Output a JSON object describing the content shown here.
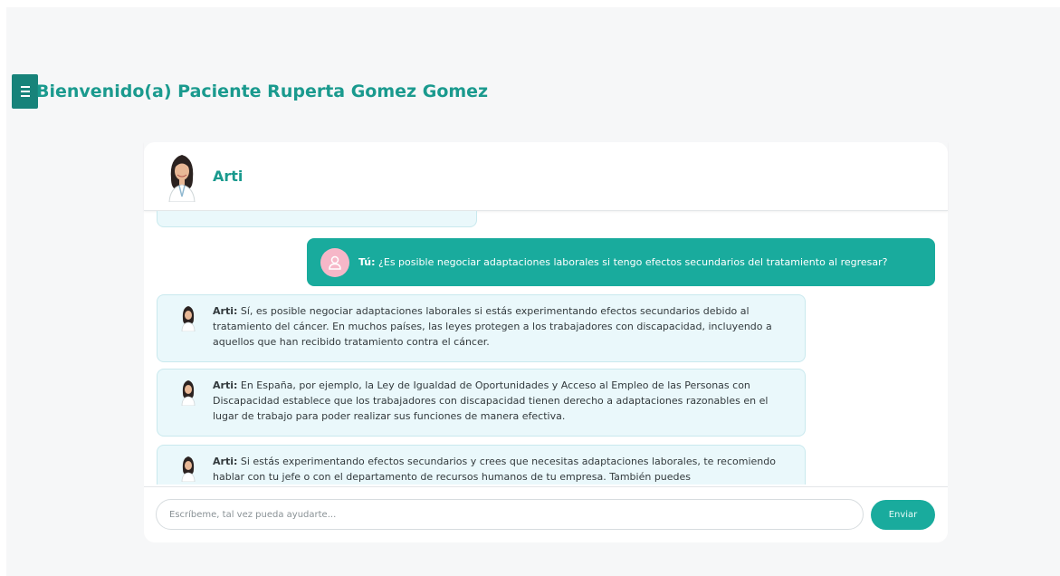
{
  "menu": {
    "icon": "hamburger-menu-icon"
  },
  "header": {
    "welcome": "Bienvenido(a) Paciente Ruperta Gomez Gomez"
  },
  "chat": {
    "bot_name": "Arti",
    "bot_avatar_icon": "doctor-avatar-icon",
    "user_avatar_icon": "user-avatar-icon",
    "messages": [
      {
        "sender": "Tú:",
        "text": " ¿Es posible negociar adaptaciones laborales si tengo efectos secundarios del tratamiento al regresar?"
      },
      {
        "sender": "Arti:",
        "text": " Sí, es posible negociar adaptaciones laborales si estás experimentando efectos secundarios debido al tratamiento del cáncer. En muchos países, las leyes protegen a los trabajadores con discapacidad, incluyendo a aquellos que han recibido tratamiento contra el cáncer."
      },
      {
        "sender": "Arti:",
        "text": " En España, por ejemplo, la Ley de Igualdad de Oportunidades y Acceso al Empleo de las Personas con Discapacidad establece que los trabajadores con discapacidad tienen derecho a adaptaciones razonables en el lugar de trabajo para poder realizar sus funciones de manera efectiva."
      },
      {
        "sender": "Arti:",
        "text": " Si estás experimentando efectos secundarios y crees que necesitas adaptaciones laborales, te recomiendo hablar con tu jefe o con el departamento de recursos humanos de tu empresa. También puedes"
      }
    ]
  },
  "input": {
    "placeholder": "Escríbeme, tal vez pueda ayudarte...",
    "value": ""
  },
  "send_button": {
    "label": "Enviar"
  },
  "colors": {
    "accent": "#19ab9d",
    "accent_dark": "#17837a",
    "bot_bubble": "#eaf8fb",
    "user_avatar": "#f6b7c8"
  }
}
